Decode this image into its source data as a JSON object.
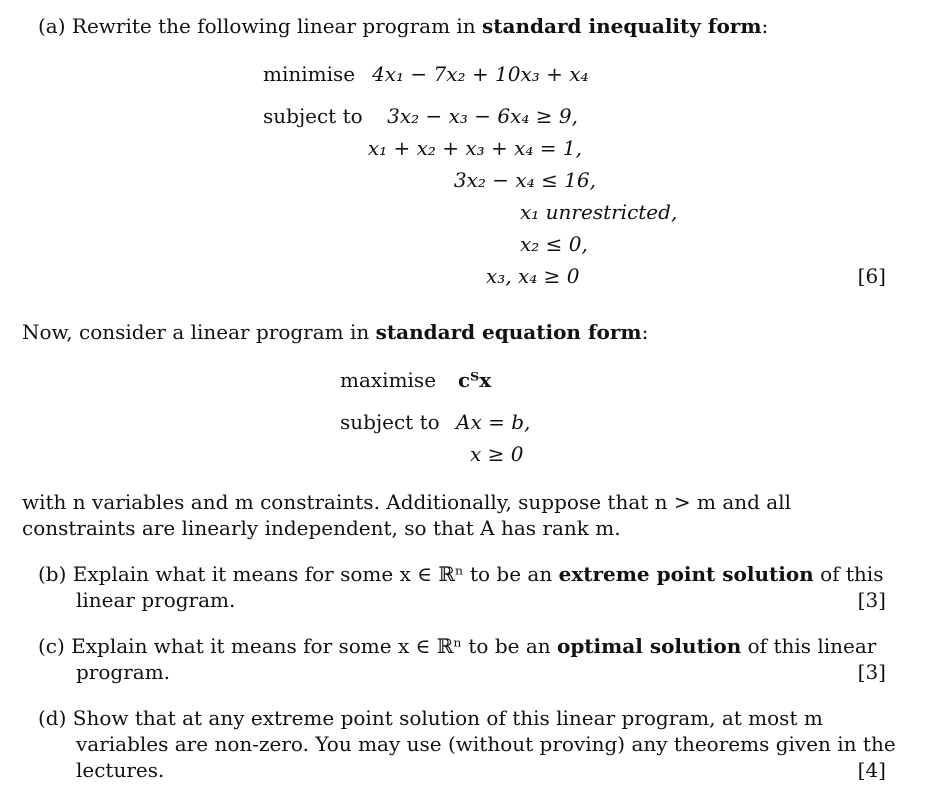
{
  "part_a": {
    "prefix": "(a) Rewrite the following linear program in ",
    "bold": "standard inequality form",
    "suffix": ":",
    "objective_label": "minimise",
    "objective": "4x₁ − 7x₂ + 10x₃ + x₄",
    "subject_label": "subject to",
    "constraints": [
      "3x₂ − x₃ − 6x₄ ≥ 9,",
      "x₁ + x₂ + x₃ + x₄ = 1,",
      "3x₂ − x₄ ≤ 16,",
      "x₁ unrestricted,",
      "x₂ ≤ 0,",
      "x₃, x₄ ≥ 0"
    ],
    "marks": "[6]"
  },
  "intro": {
    "prefix": "Now, consider a linear program in ",
    "bold": "standard equation form",
    "suffix": ":",
    "objective_label": "maximise",
    "objective": "cᵀx",
    "subject_label": "subject to",
    "constraints": [
      "Ax = b,",
      "x ≥ 0"
    ],
    "line1": "with n variables and m constraints. Additionally, suppose that n > m and all",
    "line2": "constraints are linearly independent, so that A has rank m."
  },
  "part_b": {
    "prefix": "(b) Explain what it means for some x ∈ ℝⁿ to be an ",
    "bold": "extreme point solution",
    "suffix": " of this",
    "line2": "linear program.",
    "marks": "[3]"
  },
  "part_c": {
    "prefix": "(c) Explain what it means for some x ∈ ℝⁿ to be an ",
    "bold": "optimal solution",
    "suffix": " of this linear",
    "line2": "program.",
    "marks": "[3]"
  },
  "part_d": {
    "line1": "(d) Show that at any extreme point solution of this linear program, at most m",
    "line2": "variables are non-zero. You may use (without proving) any theorems given in the",
    "line3": "lectures.",
    "marks": "[4]"
  }
}
